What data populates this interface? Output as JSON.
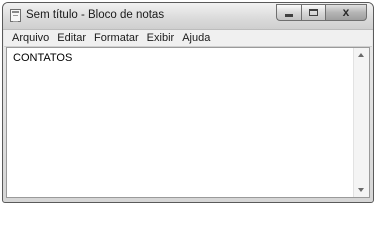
{
  "window": {
    "title": "Sem título - Bloco de notas",
    "icons": {
      "app": "notepad-icon",
      "minimize": "minimize-icon",
      "maximize": "maximize-icon",
      "close": "close-icon"
    },
    "close_glyph": "x"
  },
  "menu": {
    "items": [
      "Arquivo",
      "Editar",
      "Formatar",
      "Exibir",
      "Ajuda"
    ]
  },
  "editor": {
    "content": "CONTATOS"
  }
}
